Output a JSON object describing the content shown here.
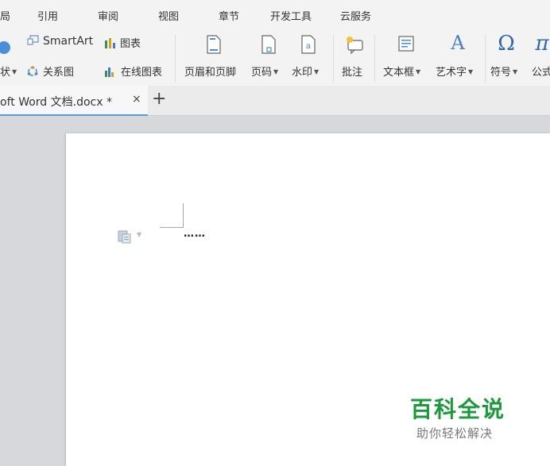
{
  "menu": {
    "items": [
      "局",
      "引用",
      "审阅",
      "视图",
      "章节",
      "开发工具",
      "云服务"
    ]
  },
  "ribbon": {
    "shape_label": "状",
    "smartart_label": "SmartArt",
    "chart_label": "图表",
    "relation_label": "关系图",
    "online_chart_label": "在线图表",
    "header_footer_label": "页眉和页脚",
    "page_number_label": "页码",
    "watermark_label": "水印",
    "comment_label": "批注",
    "textbox_label": "文本框",
    "wordart_label": "艺术字",
    "symbol_label": "符号",
    "formula_label": "公式",
    "symbol_glyph": "Ω",
    "formula_glyph": "π",
    "wordart_glyph": "A"
  },
  "tabs": {
    "document_title": "oft Word 文档.docx *",
    "close_symbol": "×",
    "new_tab_symbol": "+"
  },
  "document": {
    "text": "……"
  },
  "watermark": {
    "main": "百科全说",
    "sub": "助你轻松解决"
  },
  "colors": {
    "accent": "#5b9bd5",
    "watermark_green": "#1a9a3a",
    "wordart_blue": "#4a7ec9",
    "symbol_blue": "#2b68b5"
  }
}
